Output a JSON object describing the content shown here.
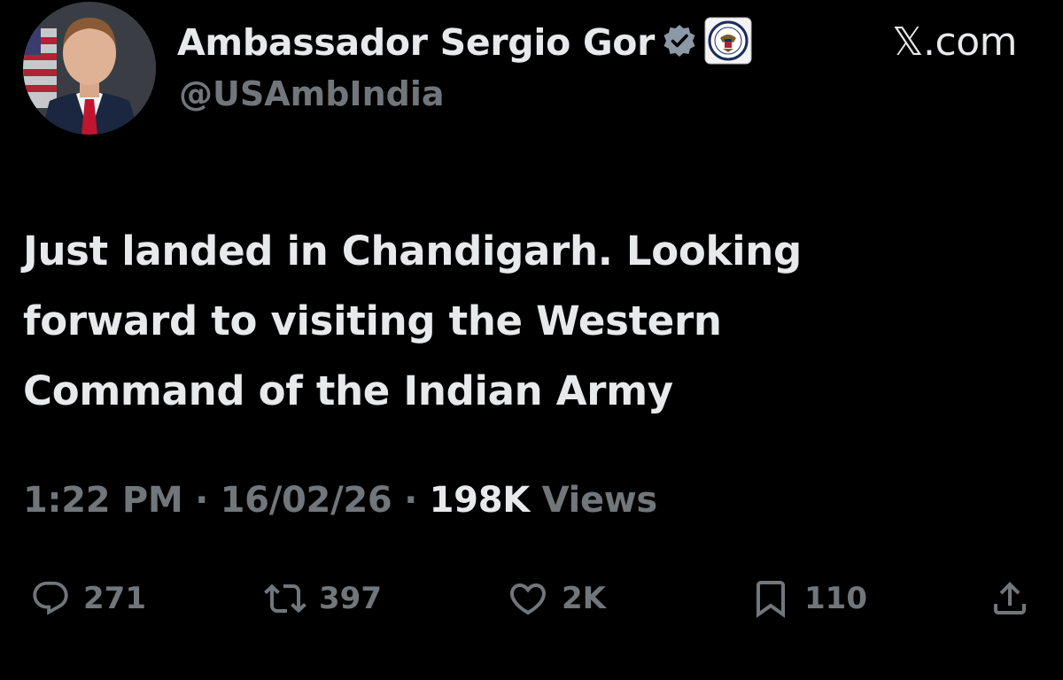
{
  "author": {
    "display_name": "Ambassador Sergio Gor",
    "handle": "@USAmbIndia",
    "verified_badge_icon": "verified-badge-icon",
    "affiliation_icon": "state-department-seal-icon",
    "avatar_icon": "profile-photo"
  },
  "brand": {
    "label": "𝕏.com"
  },
  "tweet": {
    "lines": [
      "Just landed in Chandigarh. Looking",
      "forward to visiting the Western",
      "Command of the Indian Army"
    ]
  },
  "meta": {
    "time": "1:22 PM",
    "separator": "·",
    "date": "16/02/26",
    "views_count": "198K",
    "views_label": "Views"
  },
  "actions": {
    "replies": {
      "icon": "reply-icon",
      "count": "271"
    },
    "reposts": {
      "icon": "repost-icon",
      "count": "397"
    },
    "likes": {
      "icon": "heart-icon",
      "count": "2K"
    },
    "bookmarks": {
      "icon": "bookmark-icon",
      "count": "110"
    },
    "share": {
      "icon": "share-icon"
    }
  },
  "colors": {
    "background": "#000000",
    "primary_text": "#e7e9ea",
    "secondary_text": "#71767b",
    "verified_badge": "#8b98a5"
  }
}
